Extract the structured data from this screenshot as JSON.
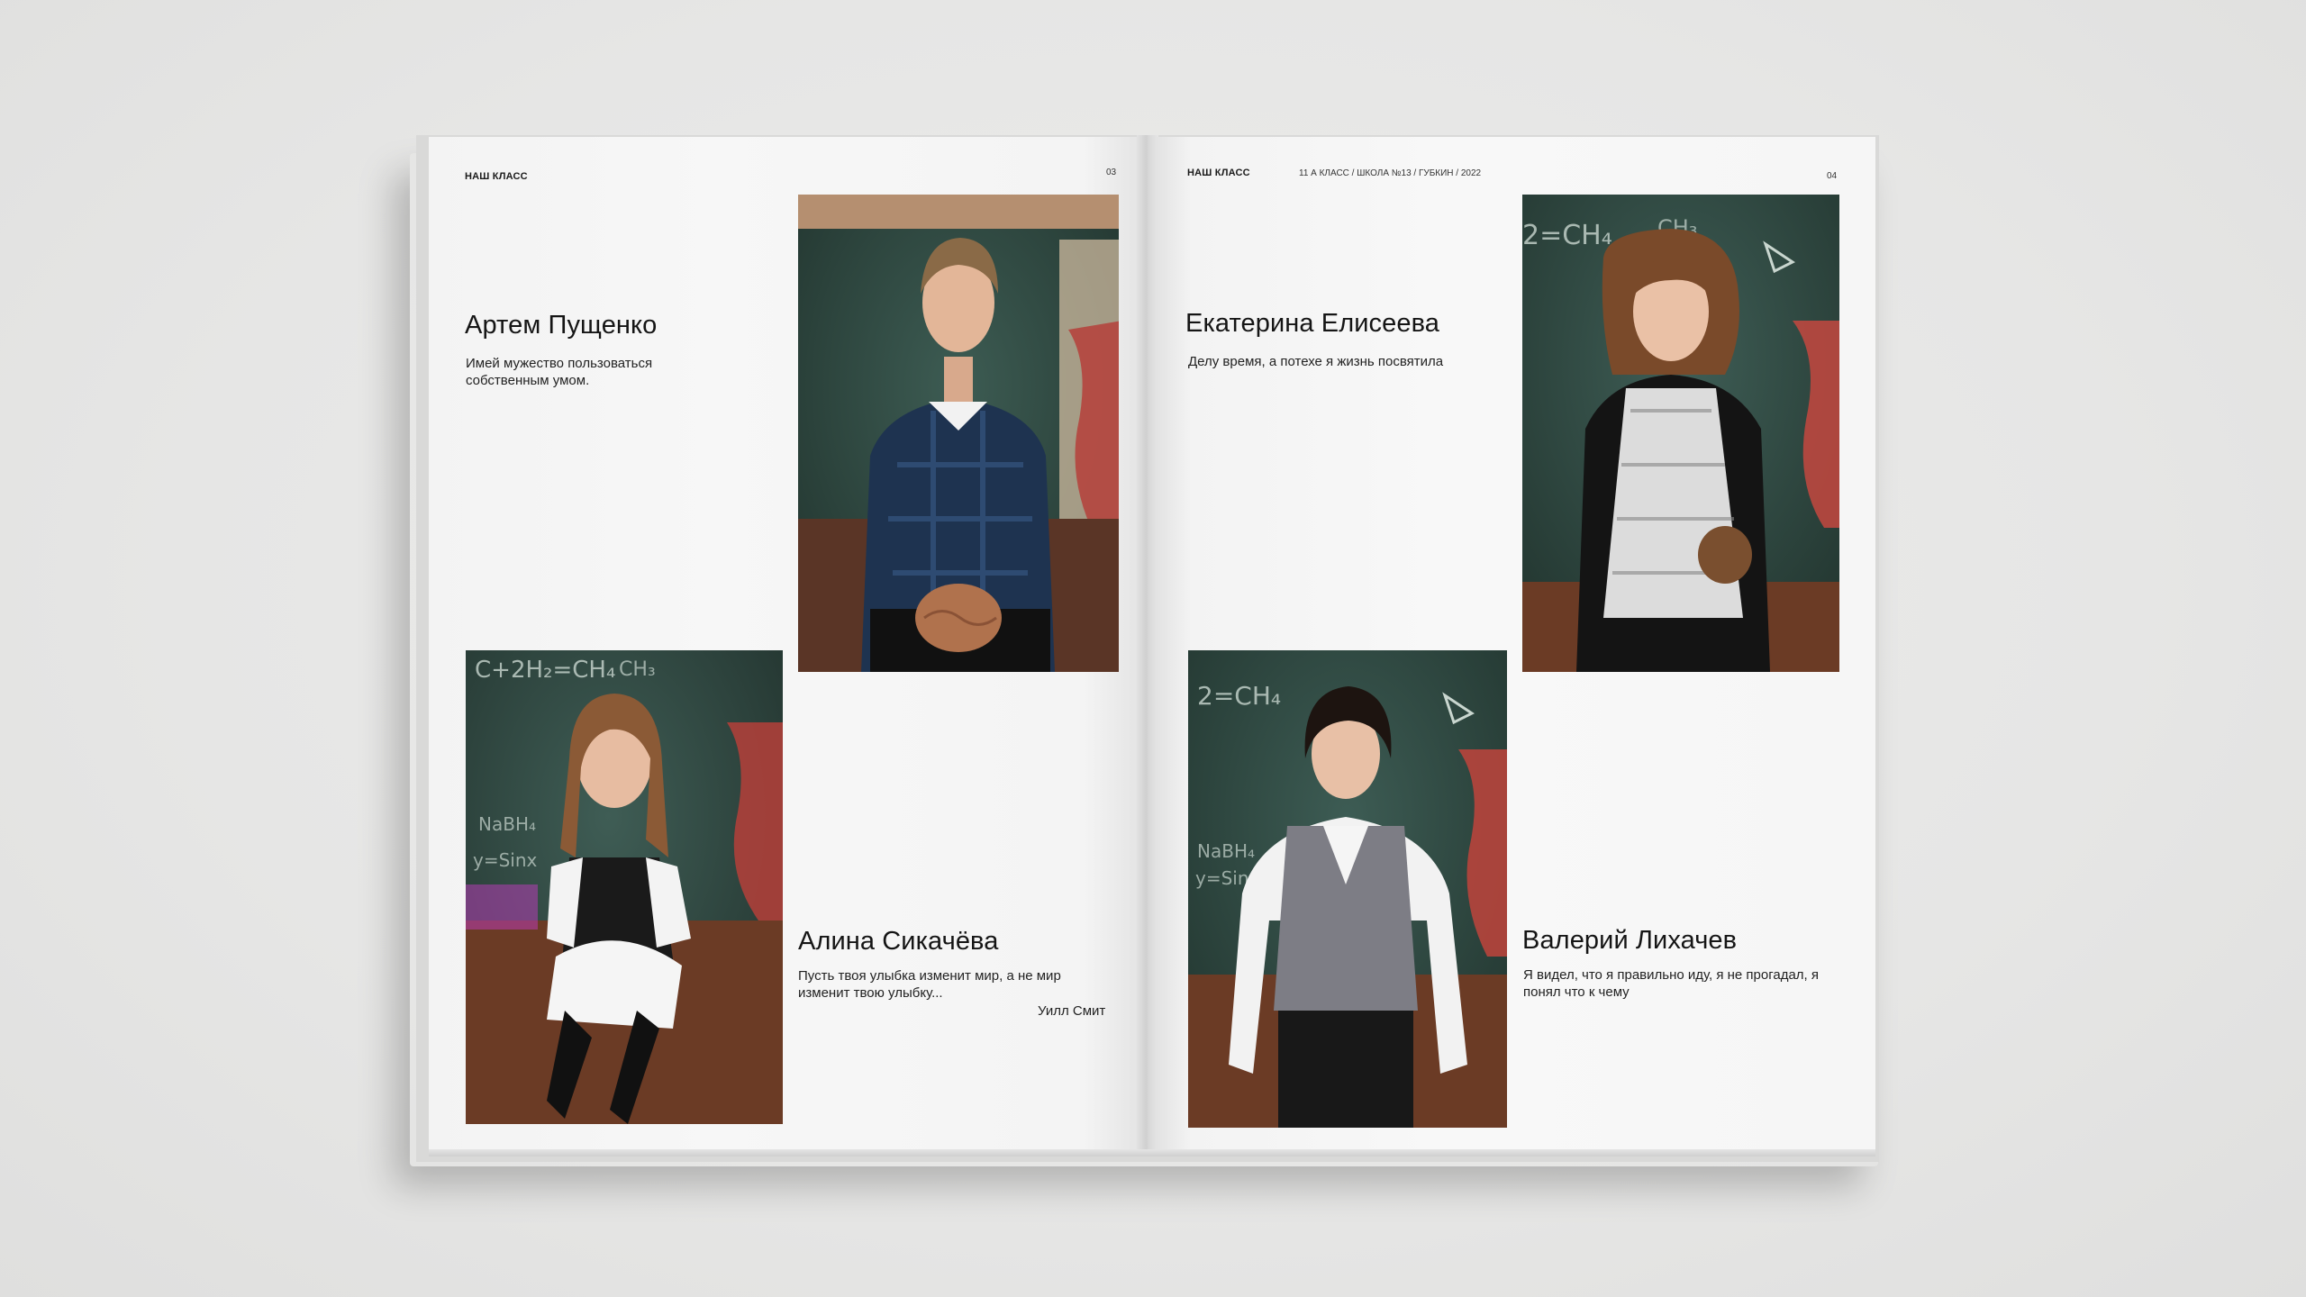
{
  "spread": {
    "left": {
      "running_head": "НАШ КЛАСС",
      "page_number": "03",
      "students": [
        {
          "name": "Артем Пущенко",
          "quote": "Имей мужество пользоваться собственным умом."
        },
        {
          "name": "Алина Сикачёва",
          "quote": "Пусть твоя улыбка изменит мир, а не мир изменит твою улыбку...",
          "author": "Уилл Смит"
        }
      ]
    },
    "right": {
      "running_head": "НАШ КЛАСС",
      "running_sub": "11 А КЛАСС / ШКОЛА №13 / ГУБКИН / 2022",
      "page_number": "04",
      "students": [
        {
          "name": "Екатерина Елисеева",
          "quote": "Делу время, а потехе я жизнь посвятила"
        },
        {
          "name": "Валерий Лихачев",
          "quote": "Я видел, что я правильно иду, я не прогадал, я понял что к чему"
        }
      ]
    }
  },
  "colors": {
    "chalkboard": "#2f4a43",
    "background": "#e8e8e7",
    "paper": "#f6f6f6"
  }
}
